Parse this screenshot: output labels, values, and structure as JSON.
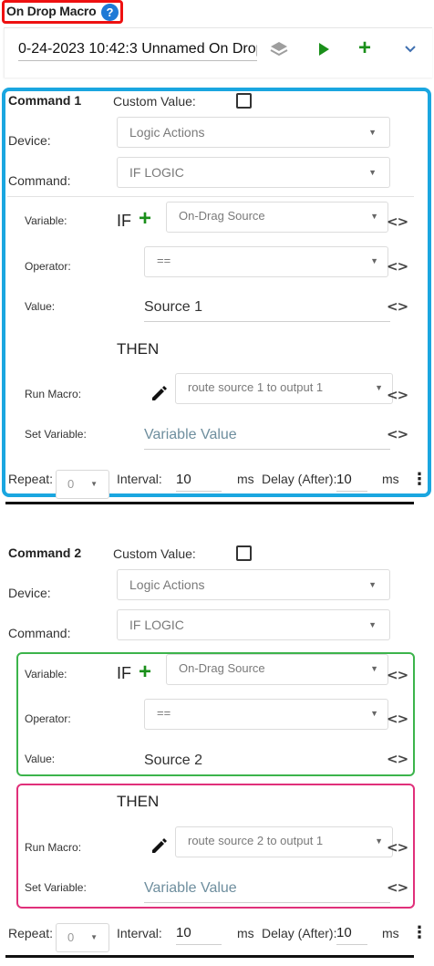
{
  "header": {
    "title": "On Drop Macro",
    "help_glyph": "?"
  },
  "toolbar": {
    "macro_name": "0-24-2023 10:42:3 Unnamed On Drop",
    "layers_icon": "layers-icon",
    "play_icon": "play-icon",
    "add_glyph": "+",
    "collapse_glyph": "⌄"
  },
  "colors": {
    "title_outline": "#ee1111",
    "command1_outline": "#1aa6e0",
    "if_outline": "#3cb44b",
    "then_outline": "#e0307a",
    "accent_green": "#1a8f1a"
  },
  "commands": [
    {
      "title": "Command 1",
      "custom_value_label": "Custom Value:",
      "custom_value_checked": false,
      "device_label": "Device:",
      "device_value": "Logic Actions",
      "command_label": "Command:",
      "command_value": "IF LOGIC",
      "if_keyword": "IF",
      "add_glyph": "+",
      "variable_label": "Variable:",
      "variable_value": "On-Drag Source",
      "operator_label": "Operator:",
      "operator_value": "==",
      "value_label": "Value:",
      "value_value": "Source 1",
      "then_keyword": "THEN",
      "run_macro_label": "Run Macro:",
      "run_macro_value": "route source 1 to output 1",
      "set_variable_label": "Set Variable:",
      "set_variable_placeholder": "Variable Value",
      "repeat_label": "Repeat:",
      "repeat_value": "0",
      "interval_label": "Interval:",
      "interval_value": "10",
      "ms_label": "ms",
      "delay_label": "Delay (After):",
      "delay_value": "10",
      "code_glyph": "<>",
      "caret_glyph": "▼",
      "more_glyph": "⋮"
    },
    {
      "title": "Command 2",
      "custom_value_label": "Custom Value:",
      "custom_value_checked": false,
      "device_label": "Device:",
      "device_value": "Logic Actions",
      "command_label": "Command:",
      "command_value": "IF LOGIC",
      "if_keyword": "IF",
      "add_glyph": "+",
      "variable_label": "Variable:",
      "variable_value": "On-Drag Source",
      "operator_label": "Operator:",
      "operator_value": "==",
      "value_label": "Value:",
      "value_value": "Source 2",
      "then_keyword": "THEN",
      "run_macro_label": "Run Macro:",
      "run_macro_value": "route source 2 to output 1",
      "set_variable_label": "Set Variable:",
      "set_variable_placeholder": "Variable Value",
      "repeat_label": "Repeat:",
      "repeat_value": "0",
      "interval_label": "Interval:",
      "interval_value": "10",
      "ms_label": "ms",
      "delay_label": "Delay (After):",
      "delay_value": "10",
      "code_glyph": "<>",
      "caret_glyph": "▼",
      "more_glyph": "⋮"
    }
  ]
}
